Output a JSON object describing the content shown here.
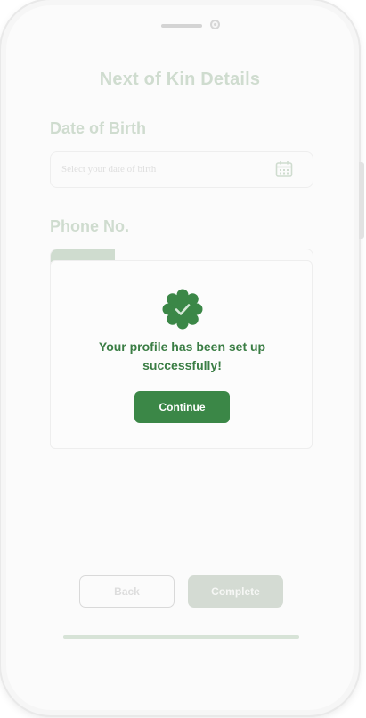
{
  "header": {
    "title": "Next of Kin Details"
  },
  "form": {
    "dob_label": "Date of Birth",
    "dob_placeholder": "Select your date of birth",
    "phone_label": "Phone No."
  },
  "modal": {
    "message_line1": "Your profile has been set up",
    "message_line2": "successfully!",
    "continue_label": "Continue"
  },
  "footer": {
    "back_label": "Back",
    "complete_label": "Complete"
  },
  "colors": {
    "accent": "#3b8747",
    "accent_text": "#3a7d44",
    "faded_green": "#cfdccf"
  },
  "icons": {
    "calendar": "calendar-icon",
    "success": "check-badge-icon"
  }
}
